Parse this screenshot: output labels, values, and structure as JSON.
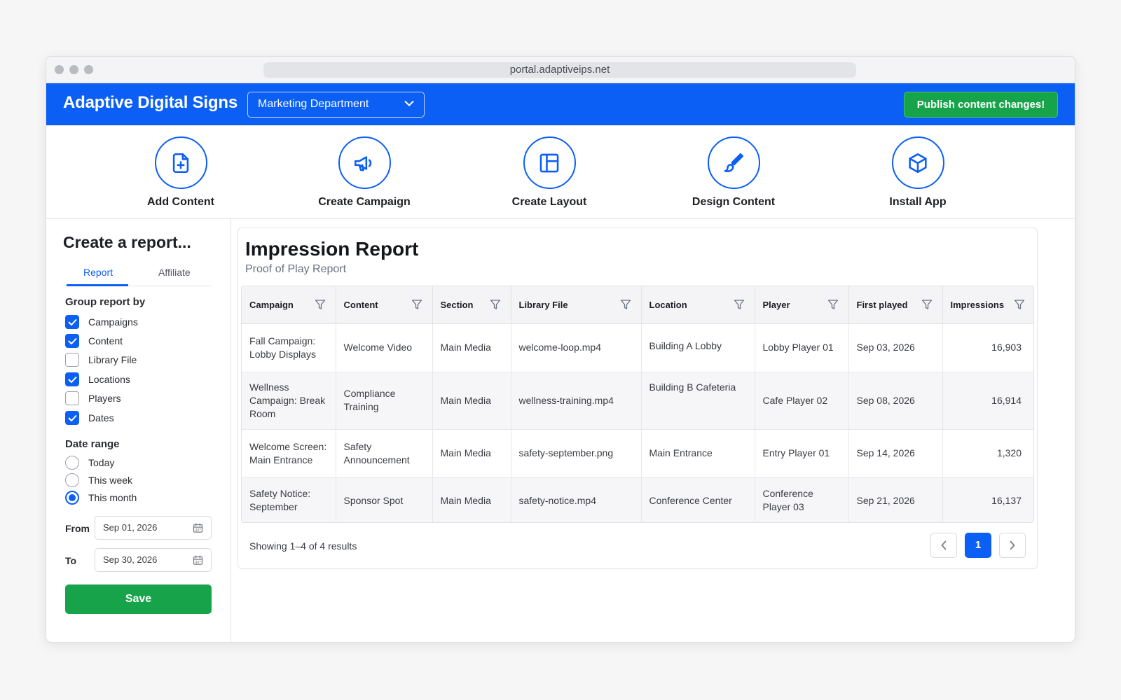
{
  "browser": {
    "url": "portal.adaptiveips.net"
  },
  "header": {
    "brand": "Adaptive Digital Signs",
    "department": "Marketing Department",
    "publish_label": "Publish content changes!"
  },
  "actions": [
    {
      "label": "Add Content",
      "icon": "file-plus-icon"
    },
    {
      "label": "Create Campaign",
      "icon": "megaphone-icon"
    },
    {
      "label": "Create Layout",
      "icon": "layout-icon"
    },
    {
      "label": "Design Content",
      "icon": "paintbrush-icon"
    },
    {
      "label": "Install App",
      "icon": "package-cube-icon"
    }
  ],
  "sidebar": {
    "title": "Create a report...",
    "tabs": [
      "Report",
      "Affiliate"
    ],
    "group_label": "Group report by",
    "group_options": [
      {
        "label": "Campaigns",
        "checked": true
      },
      {
        "label": "Content",
        "checked": true
      },
      {
        "label": "Library File",
        "checked": false
      },
      {
        "label": "Locations",
        "checked": true
      },
      {
        "label": "Players",
        "checked": false
      },
      {
        "label": "Dates",
        "checked": true
      }
    ],
    "range_label": "Date range",
    "range_options": [
      {
        "label": "Today",
        "selected": false
      },
      {
        "label": "This week",
        "selected": false
      },
      {
        "label": "This month",
        "selected": true
      }
    ],
    "from_label": "From",
    "from_value": "Sep 01, 2026",
    "to_label": "To",
    "to_value": "Sep 30, 2026",
    "save_label": "Save"
  },
  "report": {
    "title": "Impression Report",
    "subtitle": "Proof of Play Report",
    "columns": [
      "Campaign",
      "Content",
      "Section",
      "Library File",
      "Location",
      "Player",
      "First played",
      "Impressions"
    ],
    "rows": [
      [
        "Fall Campaign: Lobby Displays",
        "Welcome Video",
        "Main Media",
        "welcome-loop.mp4",
        "Building A Lobby",
        "Lobby Player 01",
        "Sep 03, 2026",
        "16,903"
      ],
      [
        "Wellness Campaign: Break Room",
        "Compliance Training",
        "Main Media",
        "wellness-training.mp4",
        "Building B Cafeteria",
        "Cafe Player 02",
        "Sep 08, 2026",
        "16,914"
      ],
      [
        "Welcome Screen: Main Entrance",
        "Safety Announcement",
        "Main Media",
        "safety-september.png",
        "Main Entrance",
        "Entry Player 01",
        "Sep 14, 2026",
        "1,320"
      ],
      [
        "Safety Notice: September",
        "Sponsor Spot",
        "Main Media",
        "safety-notice.mp4",
        "Conference Center",
        "Conference Player 03",
        "Sep 21, 2026",
        "16,137"
      ]
    ],
    "result_text": "Showing 1–4 of 4 results",
    "current_page": "1"
  },
  "colors": {
    "primary": "#0b5ff5",
    "success": "#17a34a"
  }
}
